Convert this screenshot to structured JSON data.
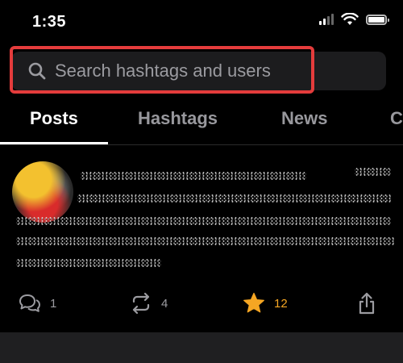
{
  "status_bar": {
    "time": "1:35"
  },
  "search": {
    "placeholder": "Search hashtags and users"
  },
  "tabs": [
    {
      "label": "Posts",
      "active": true
    },
    {
      "label": "Hashtags",
      "active": false
    },
    {
      "label": "News",
      "active": false
    },
    {
      "label": "C",
      "active": false
    }
  ],
  "post": {
    "actions": {
      "replies": "1",
      "reposts": "4",
      "stars": "12"
    }
  },
  "colors": {
    "highlight_border": "#e43c3c",
    "star_accent": "#f5a623",
    "tab_inactive": "#98989d"
  }
}
